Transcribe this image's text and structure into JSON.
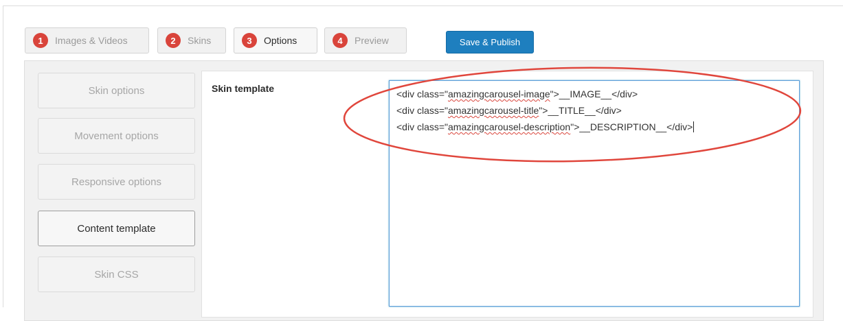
{
  "steps": [
    {
      "num": "1",
      "label": "Images & Videos",
      "active": false
    },
    {
      "num": "2",
      "label": "Skins",
      "active": false
    },
    {
      "num": "3",
      "label": "Options",
      "active": true
    },
    {
      "num": "4",
      "label": "Preview",
      "active": false
    }
  ],
  "save_label": "Save & Publish",
  "sidebar": [
    {
      "label": "Skin options",
      "active": false
    },
    {
      "label": "Movement options",
      "active": false
    },
    {
      "label": "Responsive options",
      "active": false
    },
    {
      "label": "Content template",
      "active": true
    },
    {
      "label": "Skin CSS",
      "active": false
    }
  ],
  "field_label": "Skin template",
  "template_lines": [
    {
      "pre": "<div class=\"",
      "spell": "amazingcarousel-image",
      "post": "\">__IMAGE__</div>"
    },
    {
      "pre": "<div class=\"",
      "spell": "amazingcarousel-title",
      "post": "\">__TITLE__</div>"
    },
    {
      "pre": "<div class=\"",
      "spell": "amazingcarousel-description",
      "post": "\">__DESCRIPTION__</div>"
    }
  ],
  "colors": {
    "step_badge": "#d9443b",
    "save_button": "#1e7fbf",
    "annotation": "#e0463c"
  }
}
